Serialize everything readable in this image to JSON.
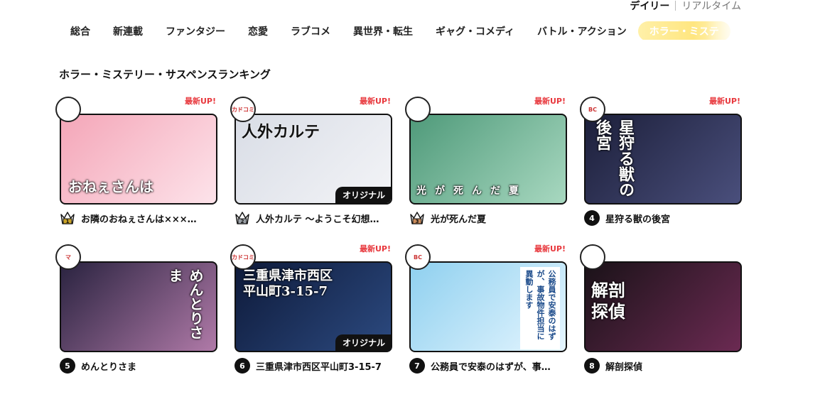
{
  "mode": {
    "daily": "デイリー",
    "realtime": "リアルタイム"
  },
  "genres": [
    {
      "label": "総合"
    },
    {
      "label": "新連載"
    },
    {
      "label": "ファンタジー"
    },
    {
      "label": "恋愛"
    },
    {
      "label": "ラブコメ"
    },
    {
      "label": "異世界・転生"
    },
    {
      "label": "ギャグ・コメディ"
    },
    {
      "label": "バトル・アクション"
    },
    {
      "label": "ホラー・ミステ"
    }
  ],
  "section_title": "ホラー・ミステリー・サスペンスランキング",
  "new_badge": "最新UP!",
  "original_label": "オリジナル",
  "cards": [
    {
      "rank": "1",
      "title": "お隣のおねぇさんは×××…",
      "pub": "",
      "new": true,
      "original": false,
      "cover_text": "おねぇさんは",
      "bg": "#f4a6b8",
      "bg2": "#fde3ea"
    },
    {
      "rank": "2",
      "title": "人外カルテ 〜ようこそ幻想…",
      "pub": "カドコミ",
      "new": true,
      "original": true,
      "cover_text": "人外カルテ",
      "bg": "#d9dde6",
      "bg2": "#f3f4f7"
    },
    {
      "rank": "3",
      "title": "光が死んだ夏",
      "pub": "",
      "new": true,
      "original": false,
      "cover_text": "光が死んだ夏",
      "bg": "#4f9a7a",
      "bg2": "#a8d8c0"
    },
    {
      "rank": "4",
      "title": "星狩る獣の後宮",
      "pub": "BC",
      "new": true,
      "original": false,
      "cover_text": "星狩る獣の後宮",
      "bg": "#1c1f3a",
      "bg2": "#4a4f7c"
    },
    {
      "rank": "5",
      "title": "めんとりさま",
      "pub": "マ",
      "new": false,
      "original": false,
      "cover_text": "めんとりさま",
      "bg": "#2a2340",
      "bg2": "#b07aa8"
    },
    {
      "rank": "6",
      "title": "三重県津市西区平山町3-15-7",
      "pub": "カドコミ",
      "new": true,
      "original": true,
      "cover_text": "三重県津市西区平山町3-15-7",
      "bg": "#0e1a3a",
      "bg2": "#2c4a80"
    },
    {
      "rank": "7",
      "title": "公務員で安泰のはずが、事…",
      "pub": "BC",
      "new": true,
      "original": false,
      "cover_text": "公務員で安泰のはずが、事故物件担当に異動します",
      "bg": "#8fd0ef",
      "bg2": "#e6f6ff"
    },
    {
      "rank": "8",
      "title": "解剖探偵",
      "pub": "",
      "new": false,
      "original": false,
      "cover_text": "解剖探偵",
      "bg": "#1a1218",
      "bg2": "#6b2a52"
    }
  ],
  "colors": {
    "accent_red": "#e8383d",
    "gold": "#c9a227",
    "silver": "#9aa0a6",
    "bronze": "#c98a5a"
  }
}
